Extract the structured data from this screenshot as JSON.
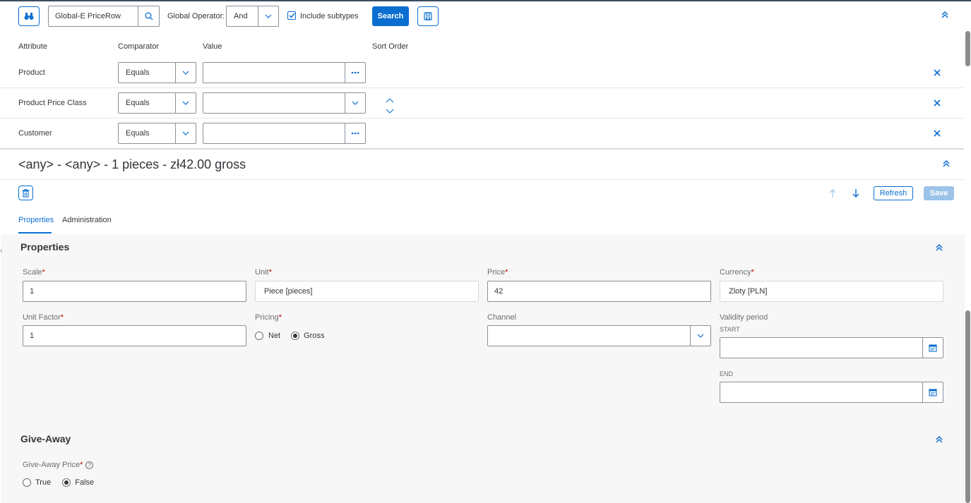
{
  "search": {
    "type_value": "Global-E PriceRow",
    "global_operator_label": "Global Operator:",
    "global_operator_value": "And",
    "include_subtypes_label": "Include subtypes",
    "search_button": "Search"
  },
  "criteria": {
    "headers": [
      "Attribute",
      "Comparator",
      "Value",
      "Sort Order"
    ],
    "rows": [
      {
        "attribute": "Product",
        "comparator": "Equals",
        "value": ""
      },
      {
        "attribute": "Product Price Class",
        "comparator": "Equals",
        "value": ""
      },
      {
        "attribute": "Customer",
        "comparator": "Equals",
        "value": ""
      }
    ]
  },
  "editor": {
    "title": "<any> - <any> - 1 pieces - zł42.00 gross",
    "refresh_button": "Refresh",
    "save_button": "Save",
    "tabs": [
      "Properties",
      "Administration"
    ],
    "active_tab": "Properties"
  },
  "properties": {
    "section_title": "Properties",
    "scale_label": "Scale",
    "scale_value": "1",
    "unit_label": "Unit",
    "unit_value": "Piece [pieces]",
    "price_label": "Price",
    "price_value": "42",
    "currency_label": "Currency",
    "currency_value": "Zloty [PLN]",
    "unit_factor_label": "Unit Factor",
    "unit_factor_value": "1",
    "pricing_label": "Pricing",
    "pricing_net": "Net",
    "pricing_gross": "Gross",
    "pricing_selected": "Gross",
    "channel_label": "Channel",
    "channel_value": "",
    "validity_label": "Validity period",
    "start_label": "START",
    "end_label": "END",
    "required_mark": "*"
  },
  "giveaway": {
    "section_title": "Give-Away",
    "price_label": "Give-Away Price",
    "true_label": "True",
    "false_label": "False",
    "selected": "False"
  },
  "colors": {
    "accent": "#0a6ed1",
    "required": "#bb0000",
    "section_bg": "#f7f7f7"
  }
}
